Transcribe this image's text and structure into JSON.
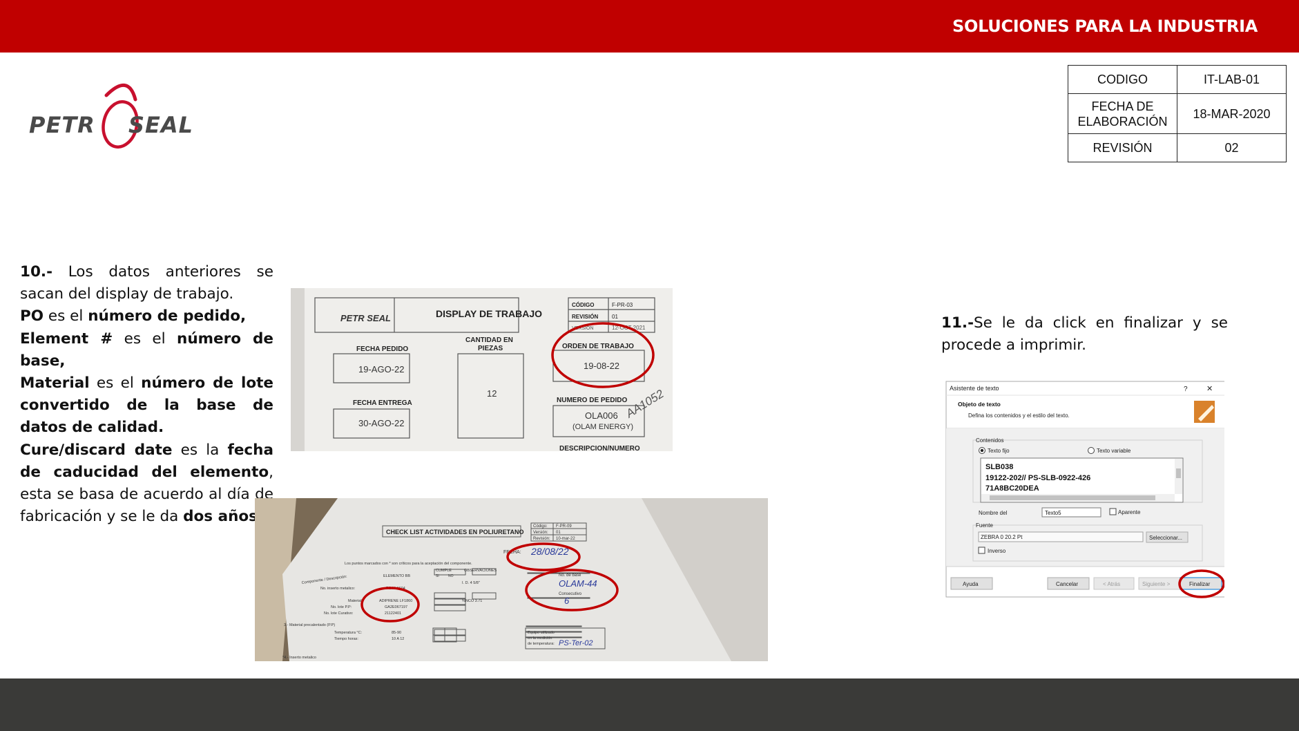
{
  "header": {
    "title": "SOLUCIONES PARA LA INDUSTRIA",
    "bar_color": "#c00000",
    "footer_color": "#3a3a38"
  },
  "logo": {
    "text_left": "PETR",
    "text_right": "SEAL",
    "accent": "#c8102e",
    "icon": "petroseal-logo"
  },
  "doc_table": {
    "codigo_label": "CODIGO",
    "codigo_value": "IT-LAB-01",
    "fecha_label_1": "FECHA DE",
    "fecha_label_2": "ELABORACIÓN",
    "fecha_value": "18-MAR-2020",
    "revision_label": "REVISIÓN",
    "revision_value": "02"
  },
  "step10": {
    "num": "10.-",
    "t1": " Los datos anteriores se sacan del display de trabajo.",
    "po": "PO",
    "po_mid": " es el ",
    "po_def": "número de pedido,",
    "el": "Element #",
    "el_mid": " es el ",
    "el_def": "número de base,",
    "mat": "Material",
    "mat_mid": " es el ",
    "mat_def": "número de lote convertido de la base de datos de calidad.",
    "cure": "Cure/discard date",
    "cure_mid": " es la ",
    "cure_def": "fecha de caducidad del elemento",
    "cure_rest": ", esta se basa de acuerdo al día de fabricación y se le da ",
    "two": "dos años",
    "end": "."
  },
  "step11": {
    "num": "11.-",
    "text": "Se le da click en finalizar y se procede a imprimir."
  },
  "photo1": {
    "logo_text": "PETR SEAL",
    "title": "DISPLAY DE TRABAJO",
    "codigo_label": "CÓDIGO",
    "codigo_value": "F-PR-03",
    "revision_label": "REVISIÓN",
    "revision_value": "01",
    "version_label": "VERSIÓN",
    "version_value": "12-OCT-2021",
    "fecha_pedido_label": "FECHA PEDIDO",
    "fecha_pedido": "19-AGO-22",
    "cantidad_label_1": "CANTIDAD EN",
    "cantidad_label_2": "PIEZAS",
    "cantidad": "12",
    "orden_label": "ORDEN DE TRABAJO",
    "orden": "19-08-22",
    "fecha_entrega_label": "FECHA ENTREGA",
    "fecha_entrega": "30-AGO-22",
    "numero_pedido_label": "NUMERO DE PEDIDO",
    "numero_pedido": "OLA006",
    "cliente": "(OLAM ENERGY)",
    "handwriting": "AA1052",
    "descripcion_label": "DESCRIPCION/NUMERO"
  },
  "photo2": {
    "title": "CHECK LIST ACTIVIDADES EN POLIURETANO",
    "codigo_label": "Código:",
    "codigo_value": "F-PR-09",
    "version_label": "Versión:",
    "version_value": "01",
    "revision_label": "Revisión:",
    "revision_value": "10-mar-22",
    "fecha_label": "FECHA:",
    "fecha": "28/08/22",
    "note": "Los puntos marcados con * son críticos para la aceptación del componente.",
    "elemento_label": "ELEMENTO BB",
    "cumple": "CUMPLE",
    "si": "SI",
    "no": "NO",
    "observaciones": "OBSERVACIONES",
    "componente_label": "Componente / Descripción:",
    "inserto_label": "No. inserto metalico:",
    "inserto": "PS-M-1604",
    "material_label": "Material:",
    "material": "ADIPRENE LF1860",
    "lote_pp_label": "No. lote P.P:",
    "lote_pp": "GA2E067197",
    "lote_curativo_label": "No. lote Curativo:",
    "lote_curativo": "21122401",
    "obs1": "I. D. 4 5/8\"",
    "obs2": "%NCO 3.71",
    "base_label": "No. de base",
    "base": "OLAM-44",
    "consecutivo_label": "Consecutivo",
    "consecutivo": "6",
    "precalentado_label": "3.- Material precalentado (P.P)",
    "temp_label": "Temperatura °C:",
    "temp": "85-90",
    "tiempo_label": "Tiempo horas:",
    "tiempo": "10 A 12",
    "equipo_1": "Equipo utilizado",
    "equipo_2": "en la medición",
    "equipo_3": "de temperatura:",
    "equipo": "PS-Ter-02",
    "inserto4": "*4.- Inserto metalico"
  },
  "dialog": {
    "title": "Asistente de texto",
    "help": "?",
    "close": "✕",
    "section": "Objeto de texto",
    "desc": "Defina los contenidos y el estilo del texto.",
    "contenidos": "Contenidos",
    "fijo": "Texto fijo",
    "variable": "Texto variable",
    "line1": "SLB038",
    "line2": "19122-202// PS-SLB-0922-426",
    "line3": "71A8BC20DEA",
    "nombre_label": "Nombre del",
    "nombre": "Texto5",
    "aparente": "Aparente",
    "fuente": "Fuente",
    "font": "ZEBRA 0 20.2 Pt",
    "seleccionar": "Seleccionar...",
    "inverso": "Inverso",
    "ayuda": "Ayuda",
    "cancelar": "Cancelar",
    "atras": "< Atrás",
    "siguiente": "Siguiente >",
    "finalizar": "Finalizar"
  }
}
